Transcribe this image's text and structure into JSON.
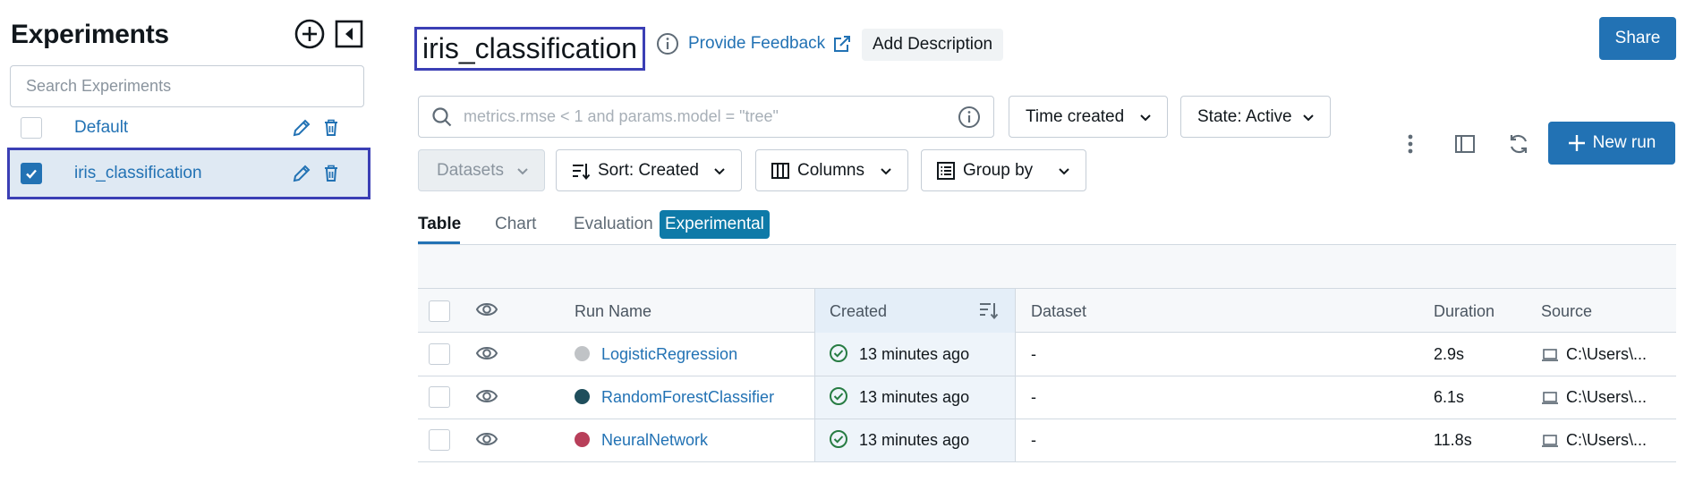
{
  "sidebar": {
    "title": "Experiments",
    "search_placeholder": "Search Experiments",
    "experiments": [
      {
        "name": "Default",
        "checked": false
      },
      {
        "name": "iris_classification",
        "checked": true
      }
    ]
  },
  "header": {
    "experiment_name": "iris_classification",
    "feedback_label": "Provide Feedback",
    "add_description_label": "Add Description",
    "share_label": "Share"
  },
  "controls": {
    "filter_placeholder": "metrics.rmse < 1 and params.model = \"tree\"",
    "time_created_label": "Time created",
    "state_label": "State: Active",
    "datasets_label": "Datasets",
    "sort_label": "Sort: Created",
    "columns_label": "Columns",
    "group_by_label": "Group by",
    "new_run_label": "New run"
  },
  "tabs": [
    {
      "label": "Table",
      "active": true
    },
    {
      "label": "Chart",
      "active": false
    },
    {
      "label": "Evaluation",
      "active": false
    }
  ],
  "experimental_badge": "Experimental",
  "table": {
    "headers": {
      "run_name": "Run Name",
      "created": "Created",
      "dataset": "Dataset",
      "duration": "Duration",
      "source": "Source"
    },
    "rows": [
      {
        "run_name": "LogisticRegression",
        "color": "#c0c3c6",
        "created": "13 minutes ago",
        "dataset": "-",
        "duration": "2.9s",
        "source": "C:\\Users\\..."
      },
      {
        "run_name": "RandomForestClassifier",
        "color": "#1f4e5c",
        "created": "13 minutes ago",
        "dataset": "-",
        "duration": "6.1s",
        "source": "C:\\Users\\..."
      },
      {
        "run_name": "NeuralNetwork",
        "color": "#b83f5a",
        "created": "13 minutes ago",
        "dataset": "-",
        "duration": "11.8s",
        "source": "C:\\Users\\..."
      }
    ]
  },
  "colors": {
    "accent": "#2272b4",
    "selection_outline": "#3b3fb5",
    "success": "#277c43"
  }
}
